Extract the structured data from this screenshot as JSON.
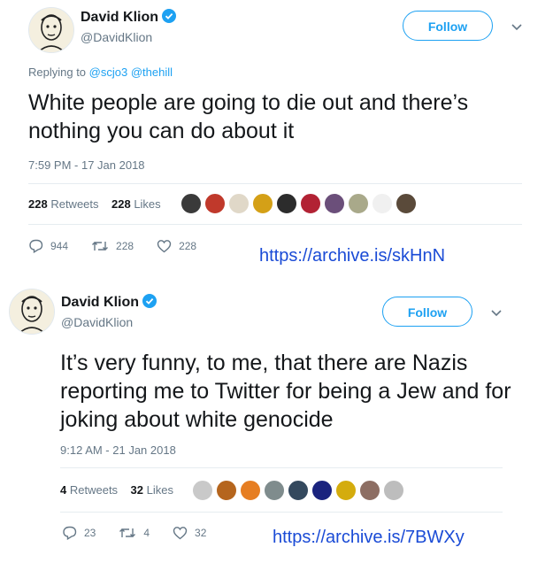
{
  "tweets": [
    {
      "author_name": "David Klion",
      "handle": "@DavidKlion",
      "follow_label": "Follow",
      "replying_prefix": "Replying to",
      "replying_to": [
        "@scjo3",
        "@thehill"
      ],
      "text": "White people are going to die out and there’s nothing you can do about it",
      "timestamp": "7:59 PM - 17 Jan 2018",
      "retweets_count": "228",
      "retweets_label": "Retweets",
      "likes_count": "228",
      "likes_label": "Likes",
      "reply_count": "944",
      "retweet_action_count": "228",
      "like_action_count": "228",
      "archive_link": "https://archive.is/skHnN",
      "liker_avatar_colors": [
        "#3a3a3a",
        "#c0392b",
        "#e0d8c8",
        "#d4a017",
        "#2c2c2c",
        "#b22234",
        "#6b4f7a",
        "#a9a98a",
        "#f0f0f0",
        "#5a4a3a"
      ]
    },
    {
      "author_name": "David Klion",
      "handle": "@DavidKlion",
      "follow_label": "Follow",
      "text": "It’s very funny, to me, that there are Nazis reporting me to Twitter for being a Jew and for joking about white genocide",
      "timestamp": "9:12 AM - 21 Jan 2018",
      "retweets_count": "4",
      "retweets_label": "Retweets",
      "likes_count": "32",
      "likes_label": "Likes",
      "reply_count": "23",
      "retweet_action_count": "4",
      "like_action_count": "32",
      "archive_link": "https://archive.is/7BWXy",
      "liker_avatar_colors": [
        "#c9c9c9",
        "#b5651d",
        "#e67e22",
        "#7f8c8d",
        "#34495e",
        "#1a237e",
        "#d4ac0d",
        "#8d6e63",
        "#bdbdbd"
      ]
    }
  ],
  "colors": {
    "accent": "#1da1f2",
    "secondary_text": "#657786",
    "archive_link": "#1a4bd6"
  },
  "icons": [
    "verified-badge-icon",
    "chevron-down-icon",
    "reply-icon",
    "retweet-icon",
    "like-icon"
  ]
}
